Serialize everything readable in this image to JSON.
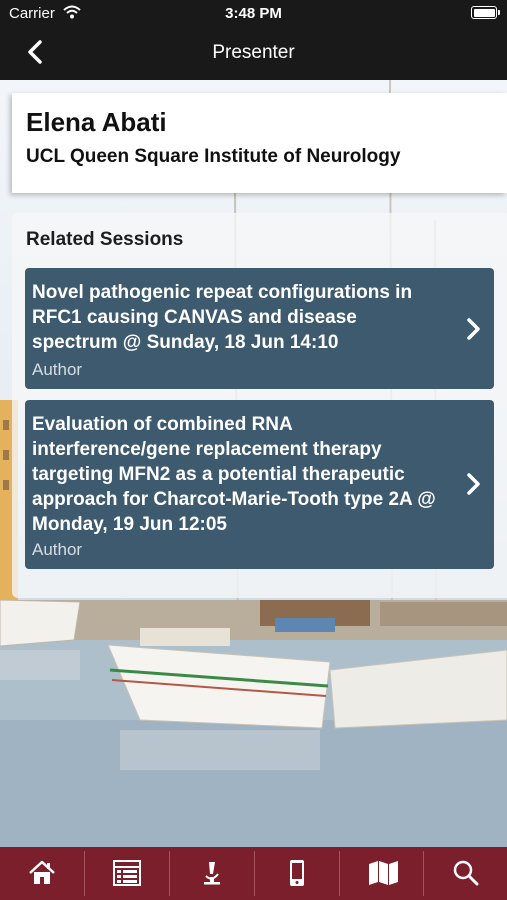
{
  "status_bar": {
    "carrier": "Carrier",
    "time": "3:48 PM"
  },
  "nav": {
    "title": "Presenter",
    "back_icon": "chevron-left-icon"
  },
  "presenter": {
    "name": "Elena Abati",
    "affiliation": "UCL Queen Square Institute of Neurology"
  },
  "related": {
    "heading": "Related Sessions",
    "sessions": [
      {
        "title": "Novel pathogenic repeat configurations in RFC1 causing CANVAS and disease spectrum @ Sunday, 18 Jun 14:10",
        "role": "Author"
      },
      {
        "title": "Evaluation of combined RNA interference/gene replacement therapy targeting MFN2 as a potential therapeutic approach for Charcot-Marie-Tooth type 2A @ Monday, 19 Jun 12:05",
        "role": "Author"
      }
    ]
  },
  "tabs": [
    {
      "name": "home",
      "icon": "home-icon"
    },
    {
      "name": "program",
      "icon": "list-icon"
    },
    {
      "name": "exhibitors",
      "icon": "microscope-icon"
    },
    {
      "name": "mobile",
      "icon": "phone-icon"
    },
    {
      "name": "map",
      "icon": "map-icon"
    },
    {
      "name": "search",
      "icon": "search-icon"
    }
  ],
  "colors": {
    "topbar": "#191919",
    "session_card": "#3e5a6f",
    "tabbar": "#7b1f2c"
  }
}
